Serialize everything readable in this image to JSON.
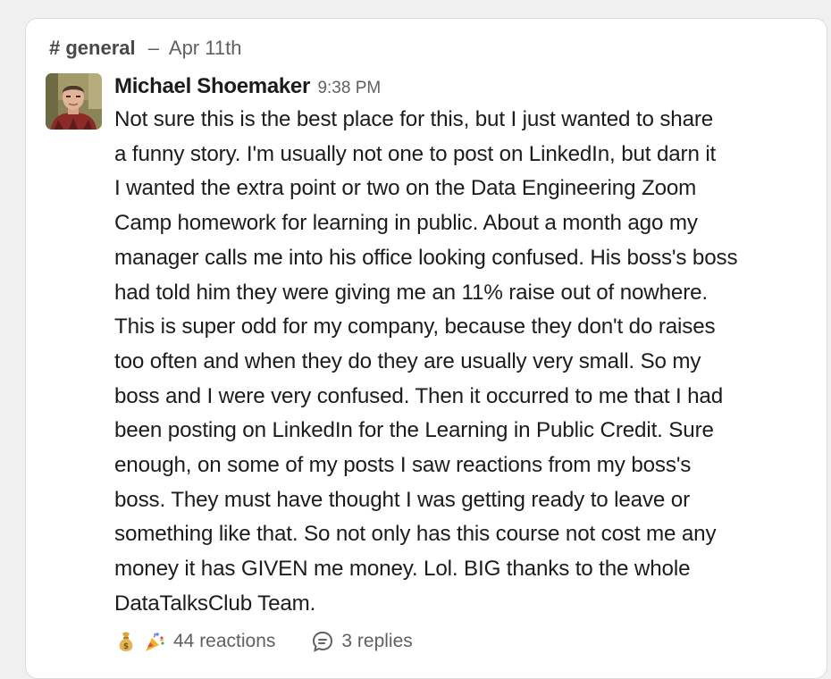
{
  "header": {
    "channel": "# general",
    "separator": "–",
    "date": "Apr 11th"
  },
  "message": {
    "author": "Michael Shoemaker",
    "time": "9:38 PM",
    "lines": [
      "Not sure this is the best place for this, but I just wanted to share",
      "a funny story. I'm usually not one to post on LinkedIn, but darn it",
      "I wanted the extra point or two on the Data Engineering Zoom",
      "Camp homework for learning in public. About a month ago my",
      "manager calls me into his office looking confused. His boss's boss",
      "had told him they were giving me an 11% raise out of nowhere.",
      "This is super odd for my company, because they don't do raises",
      "too often and when they do they are usually very small. So my",
      "boss and I were very confused. Then it occurred to me that I had",
      "been posting on LinkedIn for the Learning in Public Credit. Sure",
      "enough, on some of my posts I saw reactions from my boss's",
      "boss. They must have thought I was getting ready to leave or",
      "something like that. So not only has this course not cost me any",
      "money it has GIVEN me money. Lol. BIG thanks to the whole",
      "DataTalksClub Team."
    ]
  },
  "footer": {
    "reaction_emojis": [
      "money-bag-icon",
      "party-popper-icon"
    ],
    "reactions": "44 reactions",
    "replies": "3 replies"
  },
  "colors": {
    "text": "#1d1c1d",
    "muted": "#616061",
    "card_bg": "#ffffff",
    "page_bg": "#f0f0f0"
  }
}
